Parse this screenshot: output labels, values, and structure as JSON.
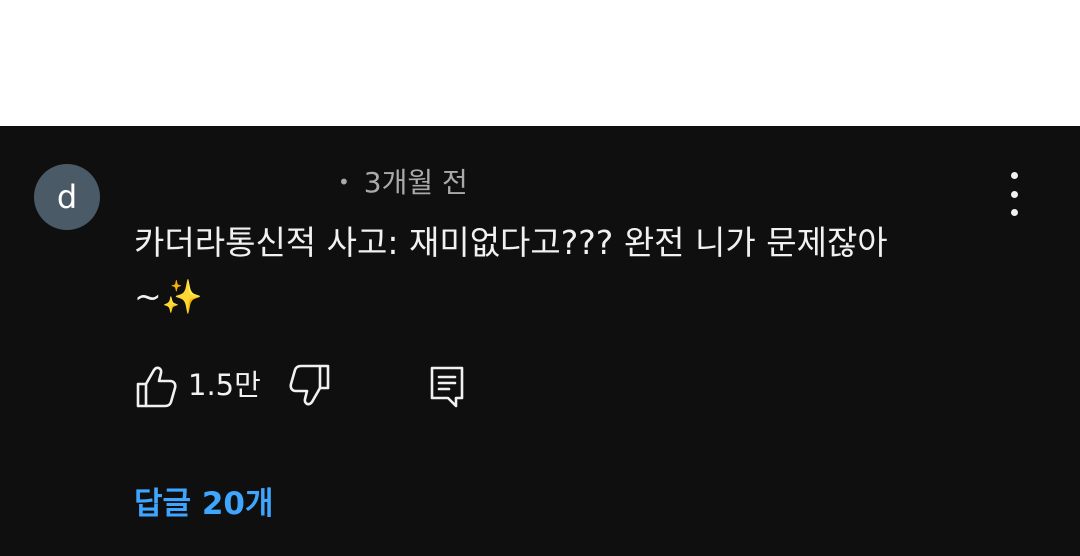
{
  "comment": {
    "avatar_letter": "d",
    "time": "3개월 전",
    "text_line1": "카더라통신적 사고: 재미없다고??? 완전 니가 문제잖아",
    "text_line2": "~✨",
    "likes": "1.5만",
    "replies_label": "답글 20개"
  },
  "colors": {
    "background": "#0f0f0f",
    "text": "#f1f1f1",
    "meta": "#aaaaaa",
    "link": "#3ea6ff",
    "avatar": "#4a5a66"
  },
  "icons": [
    "more-vertical-icon",
    "thumbs-up-icon",
    "thumbs-down-icon",
    "reply-comment-icon",
    "sparkles-emoji"
  ]
}
